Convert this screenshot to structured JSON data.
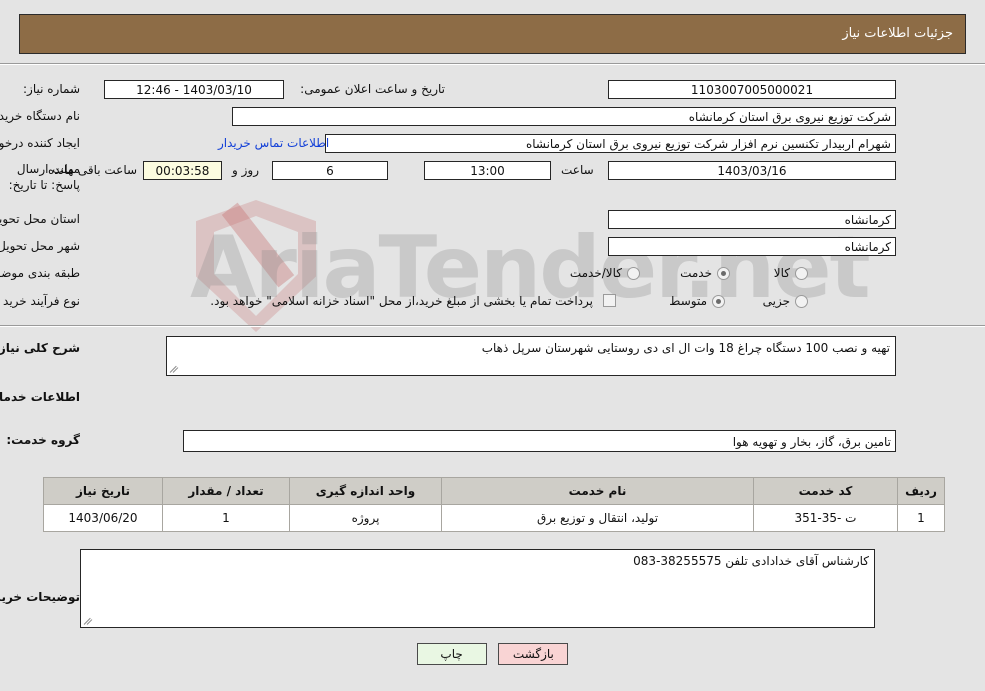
{
  "header": {
    "title": "جزئیات اطلاعات نیاز"
  },
  "watermark": {
    "text": "AriaTender.net"
  },
  "form": {
    "need_number": {
      "label": "شماره نیاز:",
      "value": "1103007005000021"
    },
    "announce_datetime": {
      "label": "تاریخ و ساعت اعلان عمومی:",
      "value": "1403/03/10 - 12:46"
    },
    "buyer_org": {
      "label": "نام دستگاه خریدار:",
      "value": "شرکت توزیع نیروی برق استان کرمانشاه"
    },
    "request_creator": {
      "label": "ایجاد کننده درخواست:",
      "value": "شهرام اربیدار تکنسین نرم افزار شرکت توزیع نیروی برق استان کرمانشاه"
    },
    "buyer_contact_link": "اطلاعات تماس خریدار",
    "deadline": {
      "label": "مهلت ارسال پاسخ: تا تاریخ:",
      "date": "1403/03/16",
      "time_label": "ساعت",
      "time": "13:00",
      "days": "6",
      "days_suffix": "روز و",
      "countdown": "00:03:58",
      "countdown_suffix": "ساعت باقی مانده"
    },
    "delivery_province": {
      "label": "استان محل تحویل:",
      "value": "کرمانشاه"
    },
    "delivery_city": {
      "label": "شهر محل تحویل:",
      "value": "کرمانشاه"
    },
    "subject_category": {
      "label": "طبقه بندی موضوعی:",
      "options": [
        {
          "label": "کالا",
          "selected": false
        },
        {
          "label": "خدمت",
          "selected": true
        },
        {
          "label": "کالا/خدمت",
          "selected": false
        }
      ]
    },
    "purchase_process": {
      "label": "نوع فرآیند خرید :",
      "options": [
        {
          "label": "جزیی",
          "selected": false
        },
        {
          "label": "متوسط",
          "selected": true
        }
      ],
      "treasury_note": "پرداخت تمام یا بخشی از مبلغ خرید،از محل \"اسناد خزانه اسلامی\" خواهد بود.",
      "treasury_checked": false
    }
  },
  "need_description": {
    "label": "شرح کلی نیاز:",
    "value": "تهیه و نصب 100 دستگاه چراغ 18 وات ال ای دی روستایی شهرستان سرپل ذهاب"
  },
  "services_section": {
    "title": "اطلاعات خدمات مورد نیاز",
    "service_group": {
      "label": "گروه خدمت:",
      "value": "تامین برق، گاز، بخار و تهویه هوا"
    }
  },
  "table": {
    "columns": [
      "ردیف",
      "کد خدمت",
      "نام خدمت",
      "واحد اندازه گیری",
      "تعداد / مقدار",
      "تاریخ نیاز"
    ],
    "rows": [
      {
        "radif": "1",
        "service_code": "ت -35-351",
        "service_name": "تولید، انتقال و توزیع برق",
        "unit": "پروژه",
        "quantity": "1",
        "need_date": "1403/06/20"
      }
    ]
  },
  "buyer_notes": {
    "label": "توضیحات خریدار:",
    "value": "کارشناس آقای خدادادی تلفن 38255575-083"
  },
  "footer": {
    "print_label": "چاپ",
    "back_label": "بازگشت"
  }
}
